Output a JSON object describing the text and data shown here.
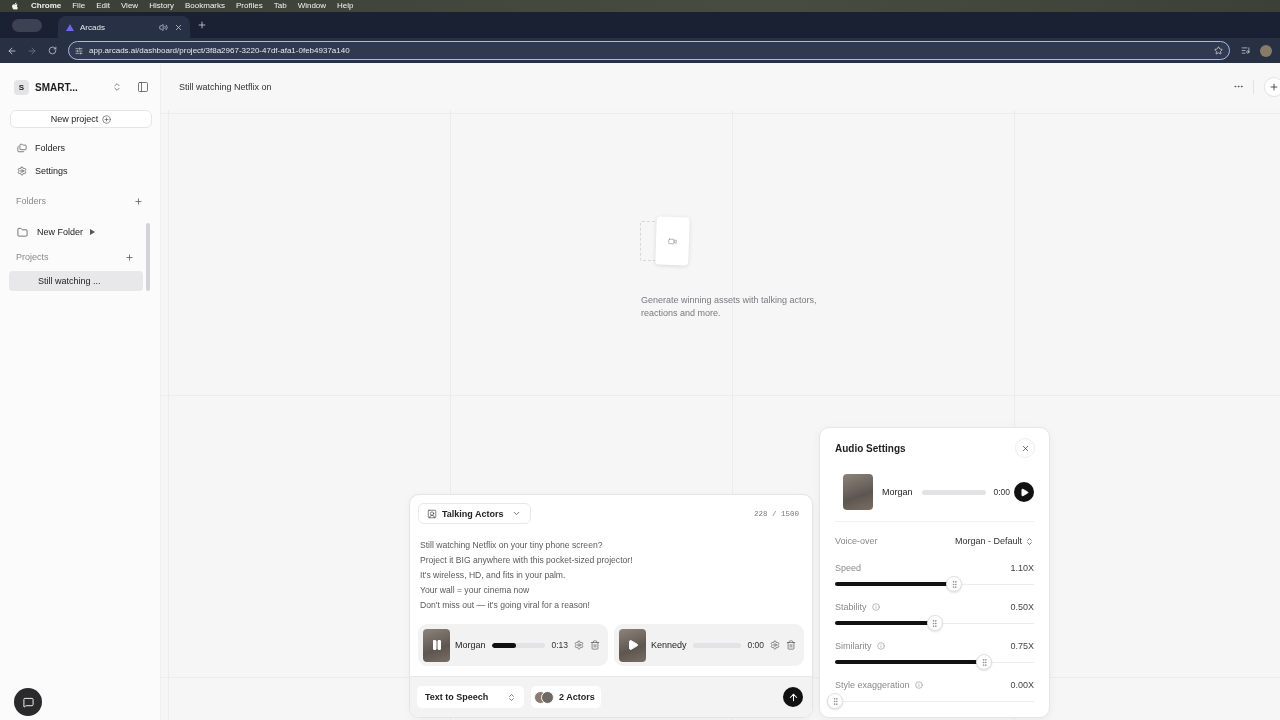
{
  "menu_bar": {
    "app": "Chrome",
    "items": [
      "File",
      "Edit",
      "View",
      "History",
      "Bookmarks",
      "Profiles",
      "Tab",
      "Window",
      "Help"
    ]
  },
  "browser": {
    "tabs": [
      {
        "title": "Arcads",
        "selected": true
      }
    ],
    "url": "app.arcads.ai/dashboard/project/3f8a2967-3220-47df-afa1-0feb4937a140"
  },
  "sidebar": {
    "workspace": {
      "initial": "S",
      "name": "SMART..."
    },
    "new_project": "New project",
    "nav": [
      {
        "kind": "folders",
        "label": "Folders"
      },
      {
        "kind": "settings",
        "label": "Settings"
      }
    ],
    "folders": {
      "title": "Folders",
      "items": [
        {
          "label": "New Folder",
          "expanded": false
        }
      ]
    },
    "projects": {
      "title": "Projects",
      "items": [
        {
          "label": "Still watching ...",
          "selected": true
        }
      ]
    }
  },
  "header": {
    "title": "Still watching Netflix on"
  },
  "empty_state": {
    "text": "Generate winning assets with talking actors, reactions and more."
  },
  "composer": {
    "mode": "Talking Actors",
    "count": "228 / 1500",
    "script": "Still watching Netflix on your tiny phone screen?\nProject it BIG anywhere with this pocket-sized projector!\nIt's wireless, HD, and fits in your palm.\nYour wall = your cinema now\nDon't miss out — it's going viral for a reason!",
    "actors": [
      {
        "name": "Morgan",
        "playing": true,
        "level": 0.45,
        "time": "0:13"
      },
      {
        "name": "Kennedy",
        "playing": false,
        "time": "0:00"
      }
    ],
    "voice_mode": "Text to Speech",
    "actors_button": "2 Actors"
  },
  "audio_settings": {
    "title": "Audio Settings",
    "preview": {
      "name": "Morgan",
      "playing": false,
      "time": "0:00"
    },
    "voice_over": {
      "label": "Voice-over",
      "value": "Morgan - Default"
    },
    "sliders": [
      {
        "label": "Speed",
        "info": false,
        "level": 0.6,
        "reading": "1.10X"
      },
      {
        "label": "Stability",
        "info": true,
        "level": 0.5,
        "reading": "0.50X"
      },
      {
        "label": "Similarity",
        "info": true,
        "level": 0.75,
        "reading": "0.75X"
      },
      {
        "label": "Style exaggeration",
        "info": true,
        "level": 0,
        "reading": "0.00X"
      }
    ]
  }
}
